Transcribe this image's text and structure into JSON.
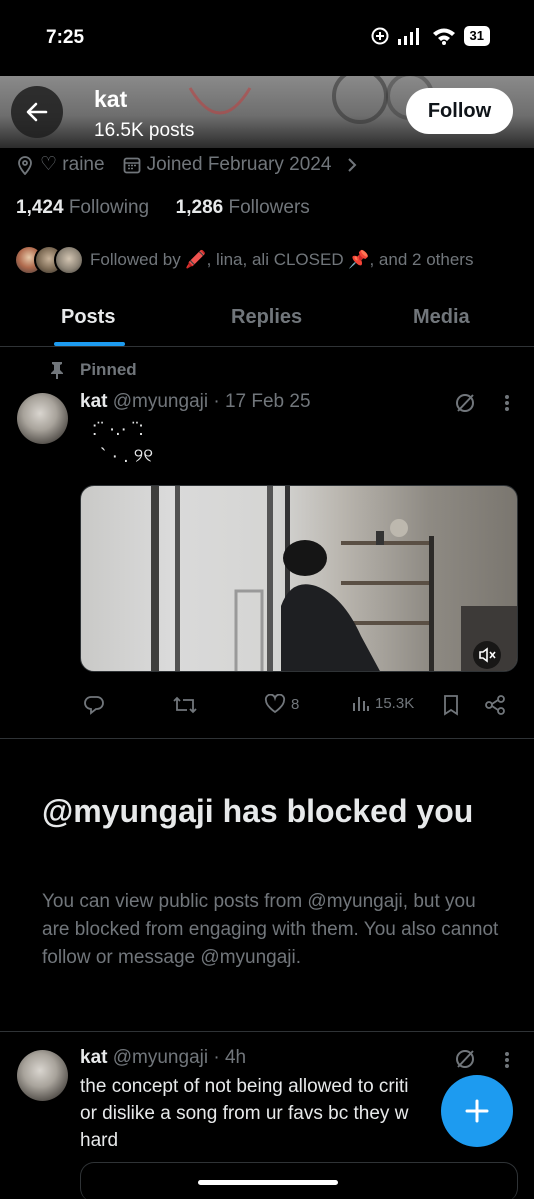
{
  "status_bar": {
    "time": "7:25",
    "battery": "31"
  },
  "header": {
    "name": "kat",
    "posts": "16.5K posts",
    "follow_label": "Follow"
  },
  "profile": {
    "location": "♡ raine",
    "joined": "Joined February 2024",
    "following_count": "1,424",
    "following_label": "Following",
    "followers_count": "1,286",
    "followers_label": "Followers",
    "followed_by": "Followed by 🖍️, lina, ali CLOSED 📌, and 2 others"
  },
  "tabs": [
    {
      "label": "Posts",
      "active": true
    },
    {
      "label": "Replies",
      "active": false
    },
    {
      "label": "Media",
      "active": false
    }
  ],
  "pinned_label": "Pinned",
  "tweet1": {
    "name": "kat",
    "handle": "@myungaji",
    "time": "· 17 Feb 25",
    "text_line1": ":¨ ·.· ¨:",
    "text_line2": "` · . ୨୧",
    "likes": "8",
    "views": "15.3K"
  },
  "blocked": {
    "title": "@myungaji has blocked you",
    "text": "You can view public posts from @myungaji, but you are blocked from engaging with them. You also cannot follow or message @myungaji."
  },
  "tweet2": {
    "name": "kat",
    "handle": "@myungaji",
    "time": "· 4h",
    "line1": "the concept of not being allowed to criti",
    "line2": "or dislike a song from  ur favs bc they w",
    "line3": "hard"
  },
  "icons": {
    "back": "arrow-left-icon",
    "location": "location-pin-icon",
    "calendar": "calendar-icon",
    "pin": "pin-icon",
    "grok": "grok-icon",
    "more": "more-icon",
    "reply": "reply-icon",
    "retweet": "retweet-icon",
    "like": "heart-icon",
    "views": "views-icon",
    "bookmark": "bookmark-icon",
    "share": "share-icon",
    "mute": "mute-icon",
    "compose": "plus-icon"
  },
  "colors": {
    "accent": "#1d9bf0",
    "muted": "#71767b",
    "text": "#e7e9ea",
    "background": "#000000"
  }
}
